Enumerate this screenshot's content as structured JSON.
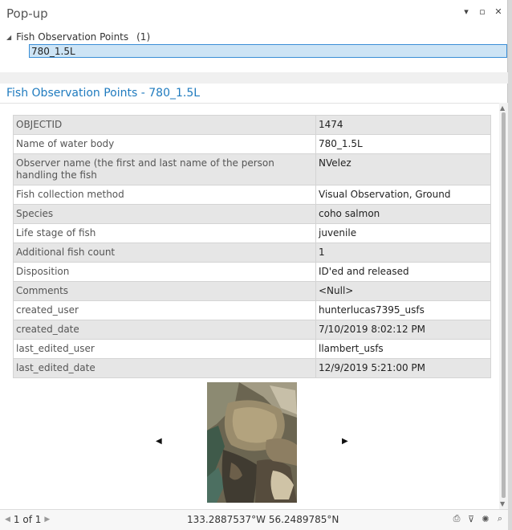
{
  "window": {
    "title": "Pop-up",
    "menu_glyph": "▾",
    "restore_glyph": "▫",
    "close_glyph": "✕"
  },
  "tree": {
    "expand_glyph": "◢",
    "layer_name": "Fish Observation Points",
    "count": "(1)",
    "selected_feature": "780_1.5L"
  },
  "detail": {
    "title": "Fish Observation Points - 780_1.5L",
    "attributes": [
      {
        "field": "OBJECTID",
        "value": "1474"
      },
      {
        "field": "Name of water body",
        "value": "780_1.5L"
      },
      {
        "field": "Observer name (the first and last name of the person handling the fish",
        "value": "NVelez"
      },
      {
        "field": "Fish collection method",
        "value": "Visual Observation, Ground"
      },
      {
        "field": "Species",
        "value": "coho salmon"
      },
      {
        "field": "Life stage of fish",
        "value": "juvenile"
      },
      {
        "field": "Additional fish count",
        "value": "1"
      },
      {
        "field": "Disposition",
        "value": "ID'ed and released"
      },
      {
        "field": "Comments",
        "value": "<Null>"
      },
      {
        "field": "created_user",
        "value": "hunterlucas7395_usfs"
      },
      {
        "field": "created_date",
        "value": "7/10/2019 8:02:12 PM"
      },
      {
        "field": "last_edited_user",
        "value": "llambert_usfs"
      },
      {
        "field": "last_edited_date",
        "value": "12/9/2019 5:21:00 PM"
      }
    ],
    "media": {
      "prev_glyph": "◀",
      "next_glyph": "▶"
    }
  },
  "scrollbar": {
    "up_glyph": "▲",
    "down_glyph": "▼"
  },
  "status": {
    "prev_glyph": "◀",
    "pager_text": "1 of 1",
    "next_glyph": "▶",
    "coordinates": "133.2887537°W 56.2489785°N"
  },
  "tools": [
    {
      "name": "print-icon",
      "glyph": "⎙"
    },
    {
      "name": "filter-icon",
      "glyph": "⊽"
    },
    {
      "name": "flash-icon",
      "glyph": "✺"
    },
    {
      "name": "zoom-to-icon",
      "glyph": "⌕"
    }
  ],
  "colors": {
    "accent": "#1f7bbf",
    "selection_fill": "#cde4f5",
    "selection_border": "#3a8ed6",
    "row_alt": "#e6e6e6"
  }
}
